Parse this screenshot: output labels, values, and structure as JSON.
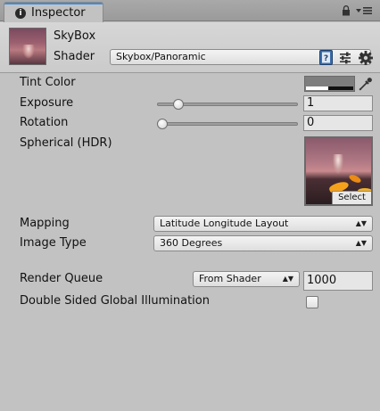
{
  "tab": {
    "label": "Inspector",
    "icon": "info-icon"
  },
  "header": {
    "material_name": "SkyBox",
    "shader_label": "Shader",
    "shader_value": "Skybox/Panoramic"
  },
  "properties": {
    "tint_color": {
      "label": "Tint Color",
      "color": "#7e7e7e",
      "alpha": 0.47
    },
    "exposure": {
      "label": "Exposure",
      "value": "1",
      "slider_fraction": 0.125
    },
    "rotation": {
      "label": "Rotation",
      "value": "0",
      "slider_fraction": 0.0
    },
    "spherical": {
      "label": "Spherical  (HDR)",
      "select_label": "Select"
    },
    "mapping": {
      "label": "Mapping",
      "value": "Latitude Longitude Layout"
    },
    "image_type": {
      "label": "Image Type",
      "value": "360 Degrees"
    },
    "render_queue": {
      "label": "Render Queue",
      "mode": "From Shader",
      "value": "1000"
    },
    "double_sided_gi": {
      "label": "Double Sided Global Illumination",
      "checked": false
    }
  },
  "colors": {
    "accent": "#3d8bd9",
    "panel_bg": "#c2c2c2"
  }
}
